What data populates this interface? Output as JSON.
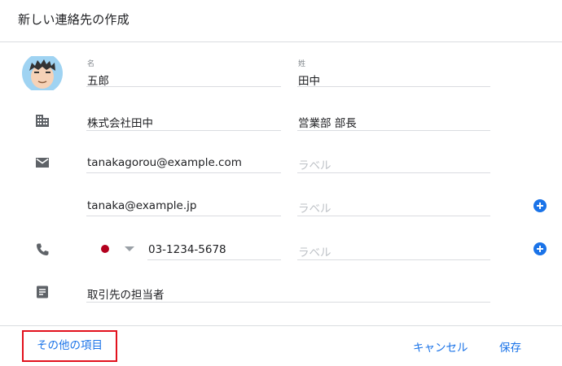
{
  "dialog": {
    "title": "新しい連絡先の作成"
  },
  "name": {
    "first_label": "名",
    "first_value": "五郎",
    "last_label": "姓",
    "last_value": "田中"
  },
  "company": {
    "name": "株式会社田中",
    "title": "営業部 部長"
  },
  "emails": [
    {
      "value": "tanakagorou@example.com",
      "label_placeholder": "ラベル"
    },
    {
      "value": "tanaka@example.jp",
      "label_placeholder": "ラベル"
    }
  ],
  "phone": {
    "number": "03-1234-5678",
    "label_placeholder": "ラベル"
  },
  "notes": {
    "value": "取引先の担当者"
  },
  "footer": {
    "more_label": "その他の項目",
    "cancel_label": "キャンセル",
    "save_label": "保存"
  },
  "icons": {
    "company": "building-icon",
    "email": "mail-icon",
    "phone": "phone-icon",
    "notes": "notes-icon",
    "add": "add-circle-icon",
    "flag": "japan-flag-icon"
  },
  "colors": {
    "accent": "#1a73e8",
    "highlight": "#e2111d",
    "icon_gray": "#5f6368"
  }
}
